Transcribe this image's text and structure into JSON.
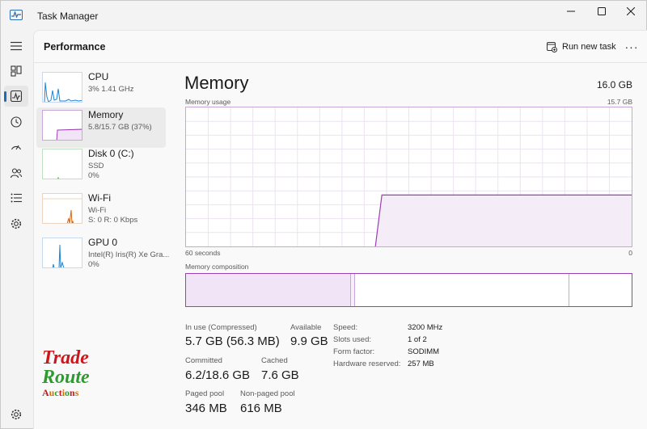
{
  "window": {
    "title": "Task Manager"
  },
  "nav": {
    "items": [
      "hamburger-menu",
      "processes",
      "performance",
      "app-history",
      "startup-apps",
      "users",
      "details",
      "services"
    ],
    "active": "performance",
    "settings": "settings"
  },
  "header": {
    "title": "Performance",
    "run_task_label": "Run new task",
    "more_label": "···"
  },
  "devices": [
    {
      "name": "CPU",
      "sub1": "3%  1.41 GHz",
      "sub2": "",
      "color": "#1a86d9"
    },
    {
      "name": "Memory",
      "sub1": "5.8/15.7 GB (37%)",
      "sub2": "",
      "color": "#9b3fb5"
    },
    {
      "name": "Disk 0 (C:)",
      "sub1": "SSD",
      "sub2": "0%",
      "color": "#4caf50"
    },
    {
      "name": "Wi-Fi",
      "sub1": "Wi-Fi",
      "sub2": "S: 0  R: 0 Kbps",
      "color": "#d2691e"
    },
    {
      "name": "GPU 0",
      "sub1": "Intel(R) Iris(R) Xe Gra...",
      "sub2": "0%",
      "color": "#1a86d9"
    }
  ],
  "memory": {
    "title": "Memory",
    "total": "16.0 GB",
    "usage_label": "Memory usage",
    "usage_max": "15.7 GB",
    "time_label": "60 seconds",
    "time_end": "0",
    "composition_label": "Memory composition",
    "usage_fraction": 0.37,
    "composition": {
      "in_use_fraction": 0.37,
      "modified_fraction": 0.01,
      "standby_fraction": 0.48
    }
  },
  "stats": {
    "in_use_label": "In use (Compressed)",
    "in_use_value": "5.7 GB (56.3 MB)",
    "available_label": "Available",
    "available_value": "9.9 GB",
    "committed_label": "Committed",
    "committed_value": "6.2/18.6 GB",
    "cached_label": "Cached",
    "cached_value": "7.6 GB",
    "paged_label": "Paged pool",
    "paged_value": "346 MB",
    "nonpaged_label": "Non-paged pool",
    "nonpaged_value": "616 MB"
  },
  "details": [
    {
      "key": "Speed:",
      "value": "3200 MHz"
    },
    {
      "key": "Slots used:",
      "value": "1 of 2"
    },
    {
      "key": "Form factor:",
      "value": "SODIMM"
    },
    {
      "key": "Hardware reserved:",
      "value": "257 MB"
    }
  ],
  "logo": {
    "line1": "Trade",
    "line2": "Route",
    "line3": "Auctions"
  },
  "colors": {
    "accent": "#1a6cb5",
    "memory": "#9b3fb5",
    "memory_fill": "#f4ecf7"
  }
}
